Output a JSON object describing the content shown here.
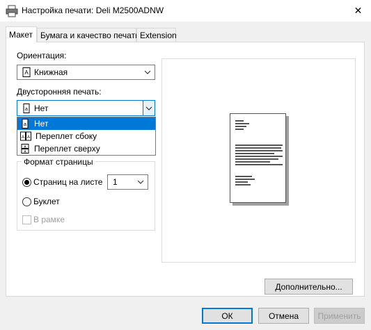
{
  "window": {
    "title": "Настройка печати: Deli M2500ADNW",
    "close_glyph": "✕"
  },
  "tabs": [
    {
      "label": "Макет",
      "active": true
    },
    {
      "label": "Бумага и качество печати",
      "active": false
    },
    {
      "label": "Extension",
      "active": false
    }
  ],
  "orientation": {
    "label": "Ориентация:",
    "value": "Книжная",
    "icon": "portrait-page-icon"
  },
  "duplex": {
    "label": "Двусторонняя печать:",
    "value": "Нет",
    "icon": "single-page-icon",
    "options": [
      {
        "label": "Нет",
        "selected": true,
        "icon": "single-page-icon"
      },
      {
        "label": "Переплет сбоку",
        "selected": false,
        "icon": "side-binding-icon"
      },
      {
        "label": "Переплет сверху",
        "selected": false,
        "icon": "top-binding-icon"
      }
    ]
  },
  "page_format": {
    "title": "Формат страницы",
    "pages_per_sheet_label": "Страниц на листе",
    "pages_per_sheet_value": "1",
    "booklet_label": "Буклет",
    "border_label": "В рамке",
    "selected": "pages_per_sheet",
    "border_checked": false,
    "border_enabled": false
  },
  "buttons": {
    "advanced": "Дополнительно...",
    "ok": "ОК",
    "cancel": "Отмена",
    "apply": "Применить"
  },
  "colors": {
    "accent": "#0078d7",
    "selection_text": "#ffffff"
  }
}
